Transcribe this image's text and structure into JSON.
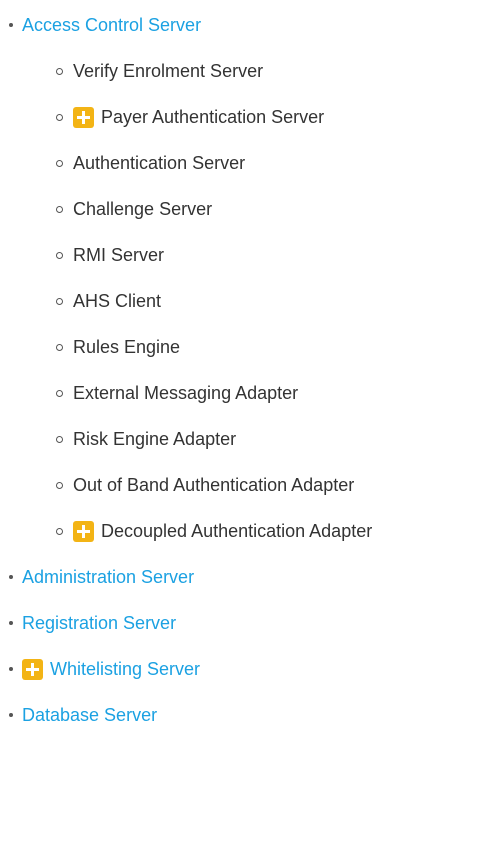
{
  "tree": {
    "acs": {
      "label": "Access Control Server"
    },
    "acs_children": [
      "Verify Enrolment Server",
      "Payer Authentication Server",
      "Authentication Server",
      "Challenge Server",
      "RMI Server",
      "AHS Client",
      "Rules Engine",
      "External Messaging Adapter",
      "Risk Engine Adapter",
      "Out of Band Authentication Adapter",
      "Decoupled Authentication Adapter"
    ],
    "administration_server": "Administration Server",
    "registration_server": "Registration Server",
    "whitelisting_server": "Whitelisting Server",
    "database_server": "Database Server"
  },
  "colors": {
    "link": "#1ba1e2",
    "text": "#333333",
    "new_badge": "#f3b415"
  },
  "icons": {
    "new_badge": "plus-icon"
  }
}
